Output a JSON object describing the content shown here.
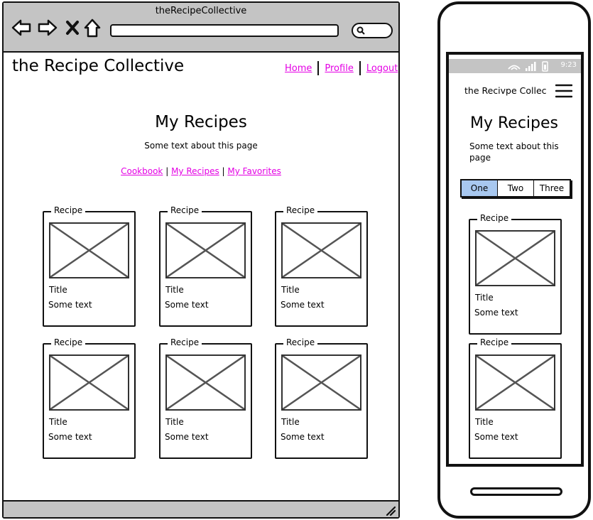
{
  "browser": {
    "window_title": "theRecipeCollective",
    "icons": [
      "back-arrow-icon",
      "forward-arrow-icon",
      "close-icon",
      "home-icon",
      "search-icon"
    ]
  },
  "site": {
    "title": "the Recipe Collective",
    "nav": [
      "Home",
      "Profile",
      "Logout"
    ]
  },
  "page": {
    "title": "My Recipes",
    "description": "Some text about this page",
    "subnav": [
      "Cookbook",
      "My Recipes",
      "My Favorites"
    ]
  },
  "cards": [
    {
      "legend": "Recipe",
      "title": "Title",
      "text": "Some text"
    },
    {
      "legend": "Recipe",
      "title": "Title",
      "text": "Some text"
    },
    {
      "legend": "Recipe",
      "title": "Title",
      "text": "Some text"
    },
    {
      "legend": "Recipe",
      "title": "Title",
      "text": "Some text"
    },
    {
      "legend": "Recipe",
      "title": "Title",
      "text": "Some text"
    },
    {
      "legend": "Recipe",
      "title": "Title",
      "text": "Some text"
    }
  ],
  "mobile": {
    "time": "9:23",
    "site_title": "the Recivpe Collec",
    "page_title": "My Recipes",
    "description": "Some text about this page",
    "tabs": [
      "One",
      "Two",
      "Three"
    ],
    "active_tab": "One",
    "cards": [
      {
        "legend": "Recipe",
        "title": "Title",
        "text": "Some text"
      },
      {
        "legend": "Recipe",
        "title": "Title",
        "text": "Some text"
      }
    ]
  },
  "colors": {
    "link": "#e400e4",
    "chrome_gray": "#c4c4c4",
    "active_tab": "#a8c8f0"
  }
}
